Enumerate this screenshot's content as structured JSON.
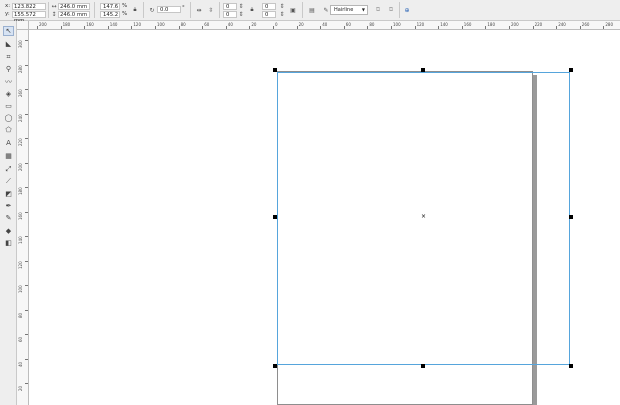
{
  "property_bar": {
    "x_label": "x:",
    "x_value": "123.822 mm",
    "y_label": "y:",
    "y_value": "155.572 mm",
    "width_value": "246.0 mm",
    "height_value": "246.0 mm",
    "scale_x": "147.6",
    "scale_x_unit": "%",
    "scale_y": "145.2",
    "scale_y_unit": "%",
    "rotation_value": "0.0",
    "rotation_unit": "°",
    "corner_top": "0",
    "corner_bottom": "0",
    "corner_top_r": "0",
    "corner_bottom_r": "0",
    "outline_width": "Hairline"
  },
  "ruler_top_labels": [
    "200",
    "180",
    "160",
    "140",
    "120",
    "100",
    "80",
    "60",
    "40",
    "20",
    "0",
    "20",
    "40",
    "60",
    "80",
    "100",
    "120",
    "140",
    "160",
    "180",
    "200",
    "220",
    "240",
    "260",
    "280"
  ],
  "ruler_left_labels": [
    "300",
    "280",
    "260",
    "240",
    "220",
    "200",
    "180",
    "160",
    "140",
    "120",
    "100",
    "80",
    "60",
    "40",
    "20"
  ],
  "toolbox": {
    "tools": [
      "pick-tool",
      "shape-tool",
      "crop-tool",
      "zoom-tool",
      "freehand-tool",
      "smart-fill-tool",
      "rectangle-tool",
      "ellipse-tool",
      "polygon-tool",
      "text-tool",
      "table-tool",
      "parallel-dimension-tool",
      "straight-connector-tool",
      "drop-shadow-tool",
      "eyedropper-tool",
      "outline-pen-tool",
      "fill-tool",
      "interactive-fill-tool"
    ]
  }
}
